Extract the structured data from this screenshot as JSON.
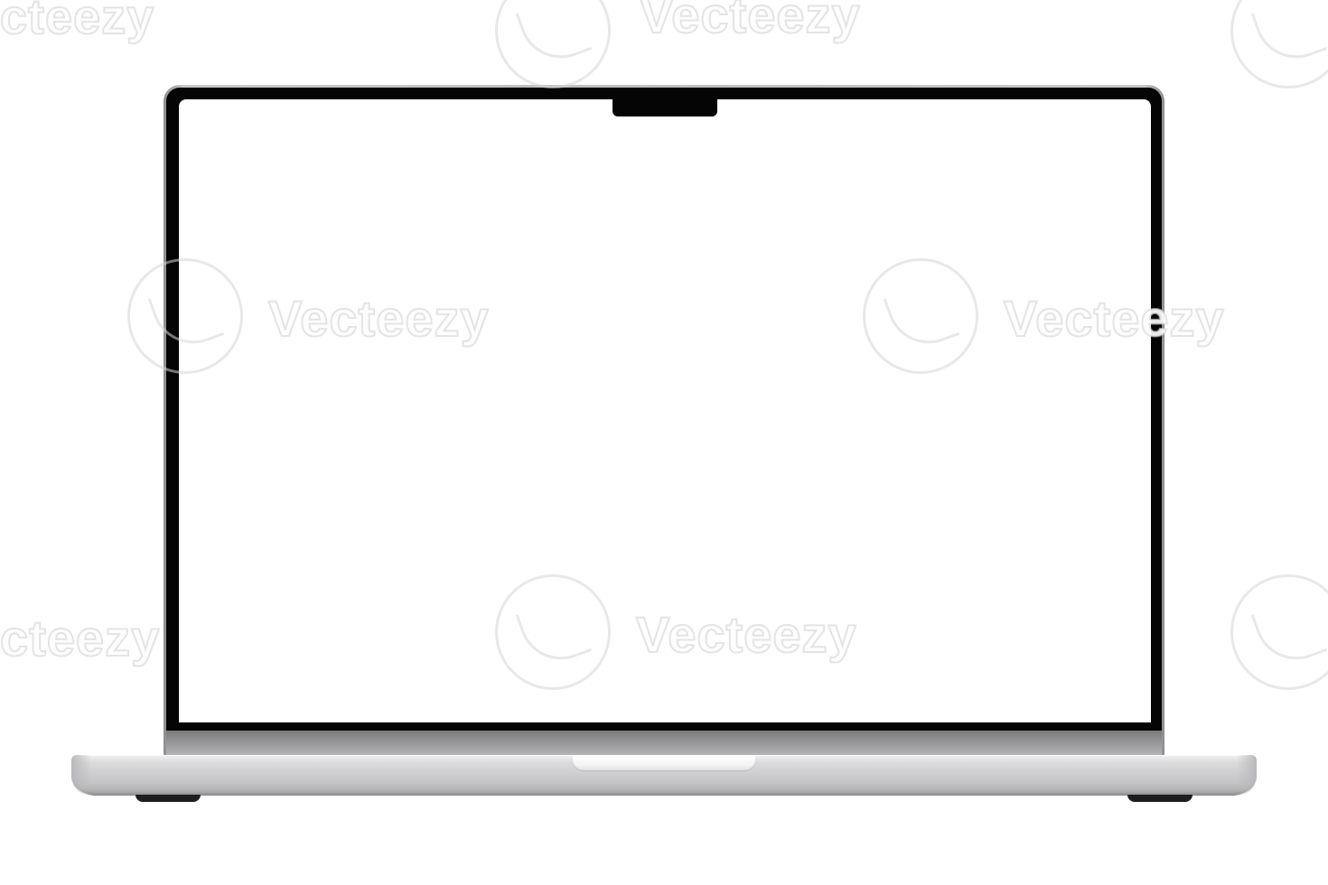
{
  "watermark": {
    "brand_text": "Vecteezy",
    "cut_left_text": "cteezy",
    "cut_top_left_text": "cteezy"
  },
  "laptop": {
    "screen": {
      "content": ""
    }
  },
  "colors": {
    "background": "#ffffff",
    "bezel": "#050505",
    "aluminum": "#c9c9cb",
    "screen": "#ffffff"
  }
}
